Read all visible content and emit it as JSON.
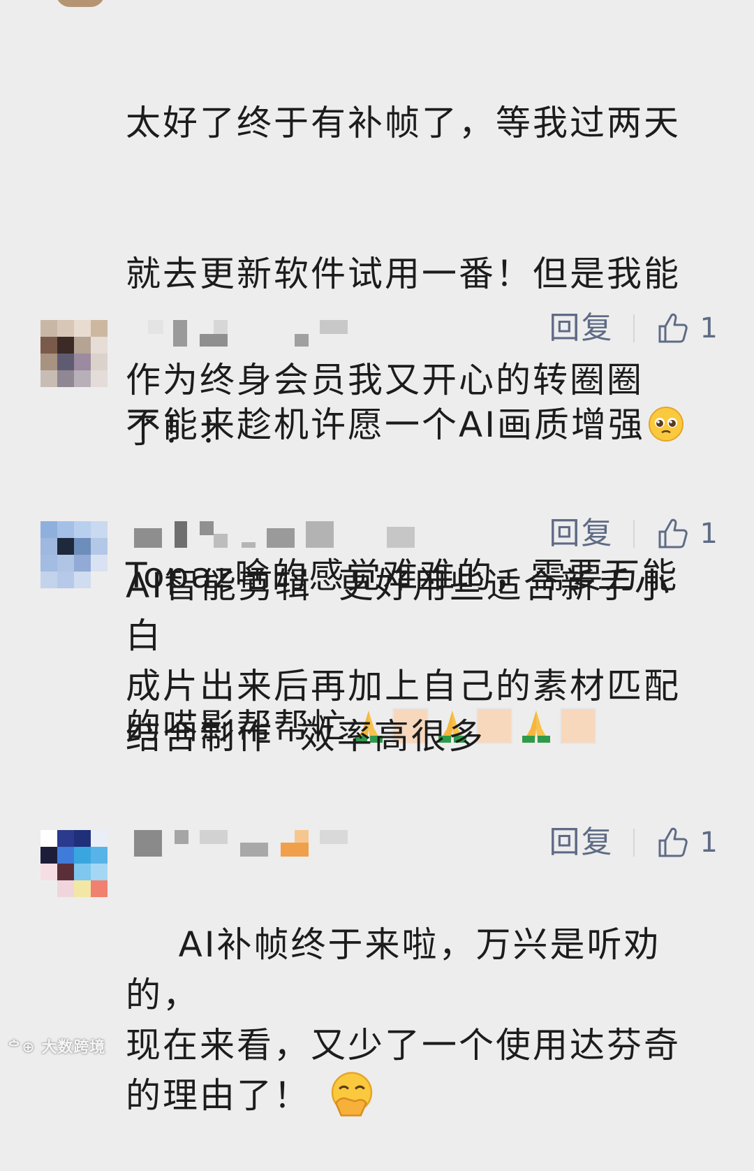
{
  "comments": [
    {
      "text_lines": [
        "太好了终于有补帧了，等我过两天",
        "就去更新软件试用一番！但是我能",
        "不能来趁机许愿一个AI画质增强",
        "Topaz啥的感觉难难的，需要万能",
        "的喵影帮帮忙"
      ]
    },
    {
      "reply_label": "回复",
      "like_count": "1",
      "text": "作为终身会员我又开心的转圈圈\n了！！"
    },
    {
      "reply_label": "回复",
      "like_count": "1",
      "text": "AI智能剪辑  更好用些适合新手小\n白\n成片出来后再加上自己的素材匹配\n结合制作  效率高很多"
    },
    {
      "reply_label": "回复",
      "like_count": "1",
      "text": "AI补帧终于来啦，万兴是听劝的，\n现在来看，又少了一个使用达芬奇\n的理由了！"
    }
  ],
  "watermark": "大数跨境",
  "icons": {
    "like": "thumbs-up-icon",
    "emoji_pleading": "pleading-face-icon",
    "emoji_pray": "folded-hands-icon",
    "emoji_giggle": "face-with-hand-over-mouth-icon"
  },
  "colors": {
    "background": "#ededed",
    "action_text": "#5f6b85",
    "body_text": "#1c1c1c"
  }
}
